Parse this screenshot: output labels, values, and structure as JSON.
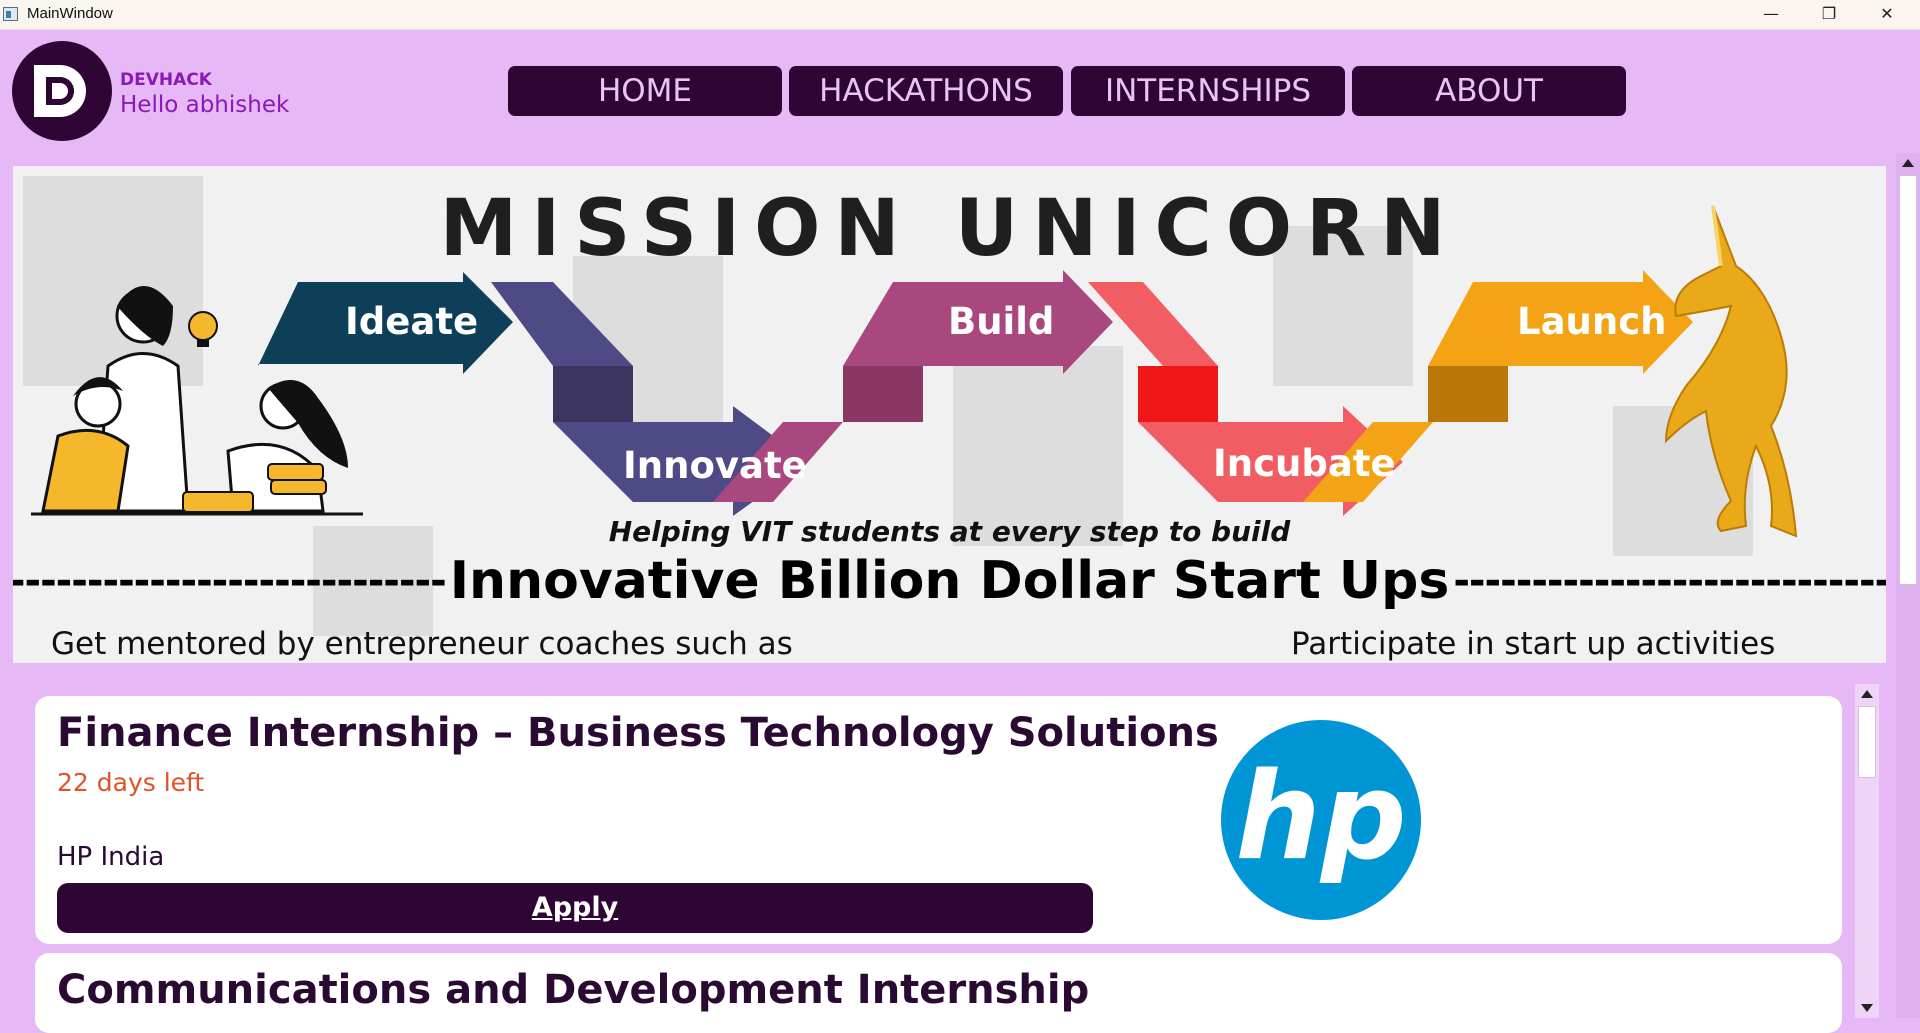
{
  "window": {
    "title": "MainWindow",
    "controls": {
      "minimize": "—",
      "maximize": "❐",
      "close": "✕"
    }
  },
  "header": {
    "brand": "DEVHACK",
    "greeting": "Hello abhishek",
    "nav": [
      "HOME",
      "HACKATHONS",
      "INTERNSHIPS",
      "ABOUT"
    ]
  },
  "banner": {
    "title": "MISSION UNICORN",
    "steps": [
      "Ideate",
      "Innovate",
      "Build",
      "Incubate",
      "Launch"
    ],
    "tagline": "Helping VIT students at every step to build",
    "headline": "Innovative Billion Dollar Start Ups",
    "sub_left": "Get mentored by entrepreneur coaches such as",
    "sub_right": "Participate in start up activities",
    "step_colors": [
      "#0d3f58",
      "#4e4a86",
      "#a9487e",
      "#f25d63",
      "#f3a314"
    ]
  },
  "internships": [
    {
      "title": "Finance Internship – Business Technology Solutions",
      "days_left": "22 days left",
      "company": "HP India",
      "apply_label": "Apply",
      "logo": "hp-logo",
      "logo_text": "hp"
    },
    {
      "title": "Communications and Development Internship"
    }
  ],
  "colors": {
    "background": "#e6b8f5",
    "nav": "#2e0534",
    "accent": "#8b18b8",
    "deadline": "#e0522a",
    "hp_blue": "#0096d6"
  }
}
